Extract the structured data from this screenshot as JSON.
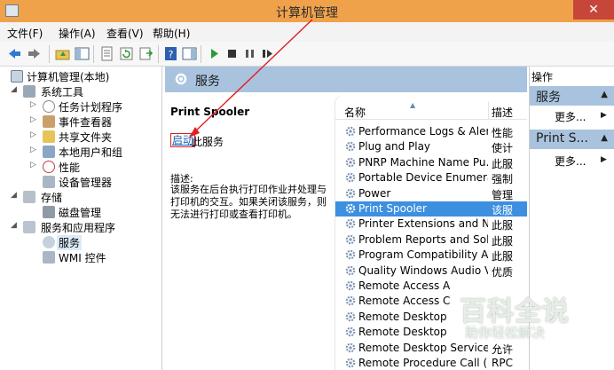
{
  "window": {
    "title": "计算机管理",
    "close_glyph": "✕"
  },
  "menu": [
    "文件(F)",
    "操作(A)",
    "查看(V)",
    "帮助(H)"
  ],
  "toolbar_icons": [
    "back-icon",
    "forward-icon",
    "up-folder-icon",
    "show-tree-icon",
    "properties-icon",
    "refresh-icon",
    "export-icon",
    "help-icon",
    "show-action-pane-icon",
    "start-icon",
    "stop-icon",
    "pause-icon",
    "restart-icon"
  ],
  "tree": {
    "root": "计算机管理(本地)",
    "system_tools": "系统工具",
    "task_scheduler": "任务计划程序",
    "event_viewer": "事件查看器",
    "shared_folders": "共享文件夹",
    "local_users": "本地用户和组",
    "performance": "性能",
    "device_manager": "设备管理器",
    "storage": "存储",
    "disk_management": "磁盘管理",
    "services_apps": "服务和应用程序",
    "services": "服务",
    "wmi": "WMI 控件"
  },
  "center": {
    "header": "服务",
    "selected_service": "Print Spooler",
    "start_link": "启动",
    "start_suffix": "此服务",
    "desc_label": "描述:",
    "description": "该服务在后台执行打印作业并处理与打印机的交互。如果关闭该服务，则无法进行打印或查看打印机。"
  },
  "list": {
    "col_name": "名称",
    "col_desc": "描述",
    "rows": [
      {
        "name": "Performance Logs & Aler...",
        "desc": "性能"
      },
      {
        "name": "Plug and Play",
        "desc": "使计"
      },
      {
        "name": "PNRP Machine Name Pu...",
        "desc": "此服"
      },
      {
        "name": "Portable Device Enumera...",
        "desc": "强制"
      },
      {
        "name": "Power",
        "desc": "管理"
      },
      {
        "name": "Print Spooler",
        "desc": "该服"
      },
      {
        "name": "Printer Extensions and N...",
        "desc": "此服"
      },
      {
        "name": "Problem Reports and Sol...",
        "desc": "此服"
      },
      {
        "name": "Program Compatibility A...",
        "desc": "此服"
      },
      {
        "name": "Quality Windows Audio V...",
        "desc": "优质"
      },
      {
        "name": "Remote Access A",
        "desc": ""
      },
      {
        "name": "Remote Access C",
        "desc": ""
      },
      {
        "name": "Remote Desktop",
        "desc": ""
      },
      {
        "name": "Remote Desktop",
        "desc": ""
      },
      {
        "name": "Remote Desktop Service...",
        "desc": "允许"
      },
      {
        "name": "Remote Procedure Call (...",
        "desc": "RPC"
      }
    ],
    "selected_index": 5
  },
  "actions": {
    "header": "操作",
    "section1": "服务",
    "more1": "更多...",
    "section2": "Print S...",
    "more2": "更多..."
  },
  "watermark": {
    "main": "百科全说",
    "sub": "助你轻松解决"
  },
  "colors": {
    "titlebar": "#f0a24a",
    "pane_header": "#a9c3de",
    "selection": "#3d8fe0",
    "annotation": "#e02020"
  }
}
